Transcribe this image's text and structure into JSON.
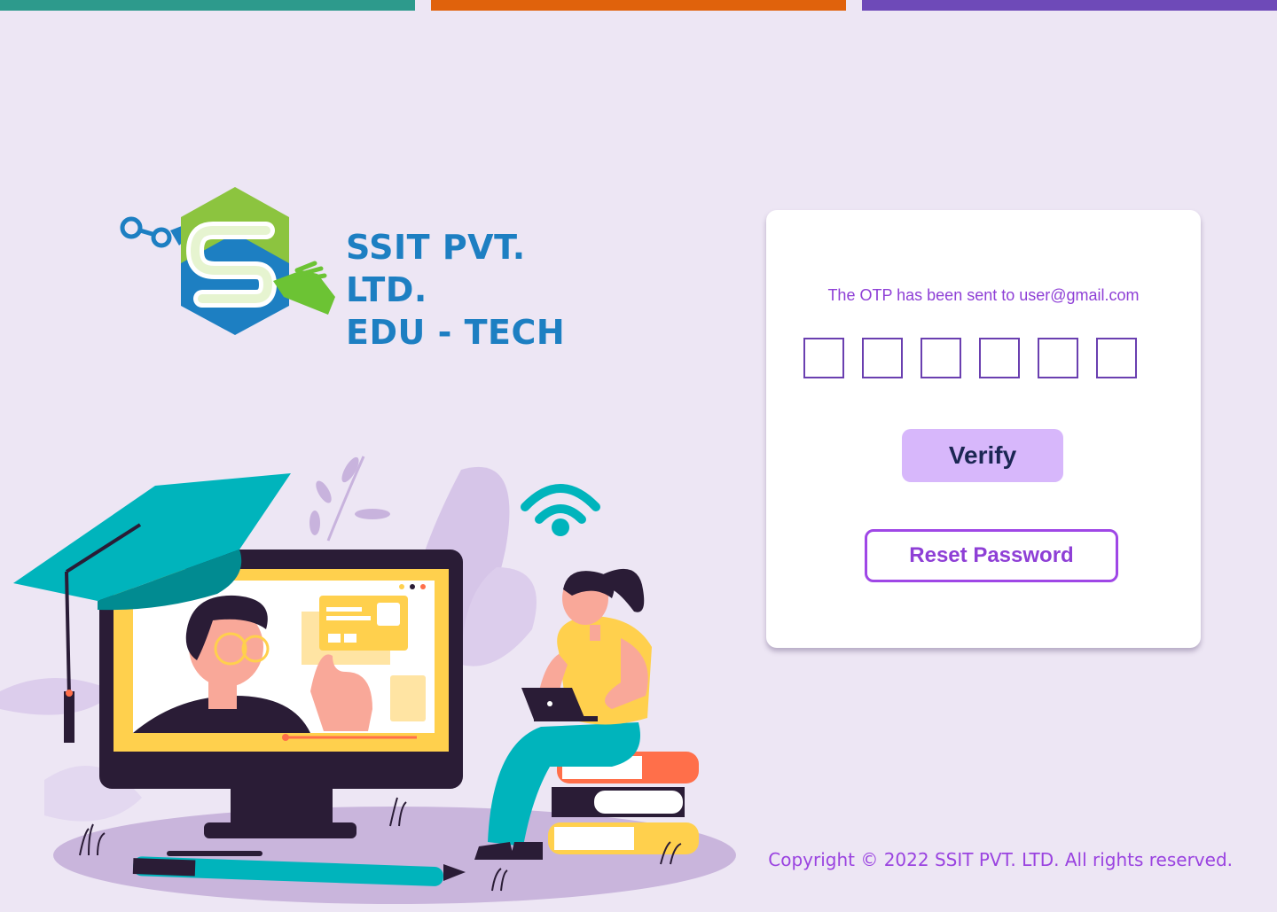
{
  "brand": {
    "line1": "SSIT PVT. LTD.",
    "line2": "EDU - TECH",
    "logo_icon": "ssit-hexagon-s-logo"
  },
  "otp": {
    "message": "The OTP has been sent to user@gmail.com",
    "digits": [
      "",
      "",
      "",
      "",
      "",
      ""
    ]
  },
  "buttons": {
    "verify_label": "Verify",
    "reset_label": "Reset Password"
  },
  "footer": {
    "copyright": "Copyright © 2022 SSIT PVT. LTD. All rights reserved."
  },
  "colors": {
    "background": "#ede6f4",
    "top_bar_1": "#2d9a8c",
    "top_bar_2": "#e0620c",
    "top_bar_3": "#6e4ab8",
    "accent_purple": "#8e3fd6",
    "verify_bg": "#d7b7fb",
    "brand_blue": "#1d7fc2",
    "brand_green": "#8cc43f"
  },
  "illustration": {
    "icon": "online-learning-illustration"
  }
}
